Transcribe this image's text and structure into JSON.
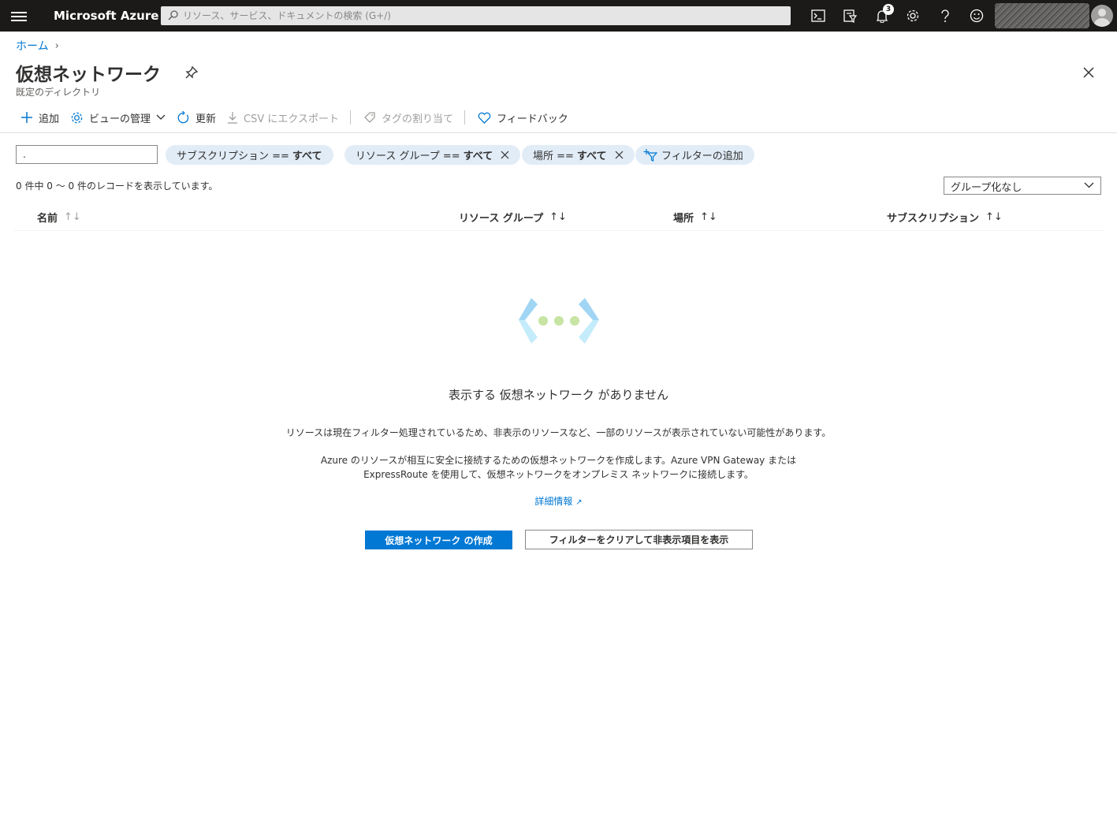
{
  "topbar": {
    "brand": "Microsoft Azure",
    "search_placeholder": "リソース、サービス、ドキュメントの検索 (G+/)",
    "notification_count": "3",
    "icons": [
      "cloud-shell-icon",
      "directory-filter-icon",
      "notifications-icon",
      "settings-icon",
      "help-icon",
      "feedback-smile-icon"
    ]
  },
  "breadcrumb": {
    "home": "ホーム"
  },
  "header": {
    "title": "仮想ネットワーク",
    "subtitle": "既定のディレクトリ"
  },
  "commands": {
    "add": "追加",
    "manage_view": "ビューの管理",
    "refresh": "更新",
    "export_csv": "CSV にエクスポート",
    "assign_tags": "タグの割り当て",
    "feedback": "フィードバック"
  },
  "filters": {
    "input_value": ".",
    "subscription": {
      "label": "サブスクリプション ==",
      "value": "すべて"
    },
    "resource_group": {
      "label": "リソース グループ ==",
      "value": "すべて"
    },
    "location": {
      "label": "場所 ==",
      "value": "すべて"
    },
    "add_filter": "フィルターの追加"
  },
  "records_text": "0 件中 0 ～ 0 件のレコードを表示しています。",
  "grouping": {
    "selected": "グループ化なし"
  },
  "columns": {
    "name": "名前",
    "resource_group": "リソース グループ",
    "location": "場所",
    "subscription": "サブスクリプション"
  },
  "empty_state": {
    "title": "表示する 仮想ネットワーク がありません",
    "filter_note": "リソースは現在フィルター処理されているため、非表示のリソースなど、一部のリソースが表示されていない可能性があります。",
    "description_line1": "Azure のリソースが相互に安全に接続するための仮想ネットワークを作成します。Azure VPN Gateway または",
    "description_line2": "ExpressRoute を使用して、仮想ネットワークをオンプレミス ネットワークに接続します。",
    "learn_more": "詳細情報",
    "create_button": "仮想ネットワーク の作成",
    "clear_filters_button": "フィルターをクリアして非表示項目を表示"
  },
  "colors": {
    "topbar_bg": "#1b1a19",
    "accent": "#0078d4",
    "pill_bg": "#e1ecf7"
  }
}
